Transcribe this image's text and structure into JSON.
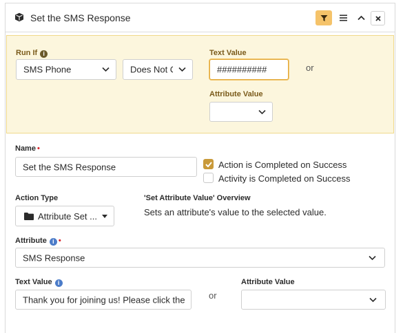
{
  "header": {
    "title": "Set the SMS Response",
    "icons": [
      "cube-icon",
      "filter-icon",
      "menu-icon",
      "chevron-up-icon",
      "close-icon"
    ]
  },
  "filter": {
    "run_if_label": "Run If",
    "run_if_field": "SMS Phone",
    "run_if_operator": "Does Not C",
    "text_value_label": "Text Value",
    "text_value": "##########",
    "or_label": "or",
    "attribute_value_label": "Attribute Value",
    "attribute_value": ""
  },
  "form": {
    "name_label": "Name",
    "name_value": "Set the SMS Response",
    "action_completed_label": "Action is Completed on Success",
    "action_completed_checked": true,
    "activity_completed_label": "Activity is Completed on Success",
    "activity_completed_checked": false,
    "action_type_label": "Action Type",
    "action_type_value": "Attribute Set ...",
    "overview_title": "'Set Attribute Value' Overview",
    "overview_text": "Sets an attribute's value to the selected value.",
    "attribute_label": "Attribute",
    "attribute_value": "SMS Response",
    "text_value_label": "Text Value",
    "text_value": "Thank you for joining us!  Please click the",
    "or_label": "or",
    "attribute_value_label": "Attribute Value",
    "attribute_value_select": ""
  },
  "colors": {
    "accent": "#f5c36a",
    "filter_bg": "#fcf6dd",
    "checkbox_on": "#c99a3a",
    "required": "#d9262c",
    "info_blue": "#4c7cc9"
  }
}
